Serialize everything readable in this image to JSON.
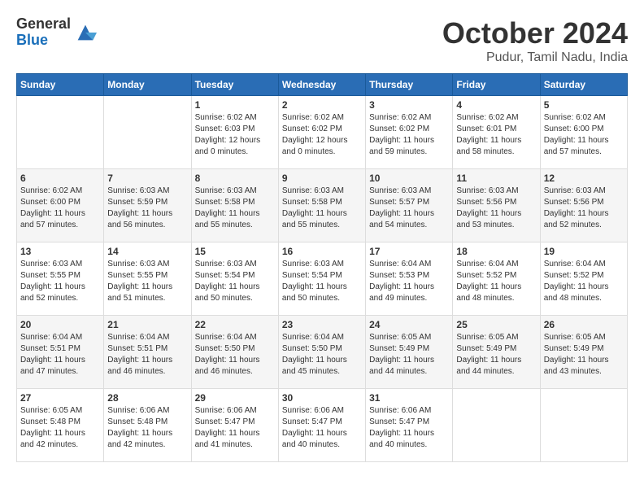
{
  "header": {
    "logo_general": "General",
    "logo_blue": "Blue",
    "title": "October 2024",
    "location": "Pudur, Tamil Nadu, India"
  },
  "calendar": {
    "days_of_week": [
      "Sunday",
      "Monday",
      "Tuesday",
      "Wednesday",
      "Thursday",
      "Friday",
      "Saturday"
    ],
    "weeks": [
      [
        {
          "day": "",
          "sunrise": "",
          "sunset": "",
          "daylight": ""
        },
        {
          "day": "",
          "sunrise": "",
          "sunset": "",
          "daylight": ""
        },
        {
          "day": "1",
          "sunrise": "Sunrise: 6:02 AM",
          "sunset": "Sunset: 6:03 PM",
          "daylight": "Daylight: 12 hours and 0 minutes."
        },
        {
          "day": "2",
          "sunrise": "Sunrise: 6:02 AM",
          "sunset": "Sunset: 6:02 PM",
          "daylight": "Daylight: 12 hours and 0 minutes."
        },
        {
          "day": "3",
          "sunrise": "Sunrise: 6:02 AM",
          "sunset": "Sunset: 6:02 PM",
          "daylight": "Daylight: 11 hours and 59 minutes."
        },
        {
          "day": "4",
          "sunrise": "Sunrise: 6:02 AM",
          "sunset": "Sunset: 6:01 PM",
          "daylight": "Daylight: 11 hours and 58 minutes."
        },
        {
          "day": "5",
          "sunrise": "Sunrise: 6:02 AM",
          "sunset": "Sunset: 6:00 PM",
          "daylight": "Daylight: 11 hours and 57 minutes."
        }
      ],
      [
        {
          "day": "6",
          "sunrise": "Sunrise: 6:02 AM",
          "sunset": "Sunset: 6:00 PM",
          "daylight": "Daylight: 11 hours and 57 minutes."
        },
        {
          "day": "7",
          "sunrise": "Sunrise: 6:03 AM",
          "sunset": "Sunset: 5:59 PM",
          "daylight": "Daylight: 11 hours and 56 minutes."
        },
        {
          "day": "8",
          "sunrise": "Sunrise: 6:03 AM",
          "sunset": "Sunset: 5:58 PM",
          "daylight": "Daylight: 11 hours and 55 minutes."
        },
        {
          "day": "9",
          "sunrise": "Sunrise: 6:03 AM",
          "sunset": "Sunset: 5:58 PM",
          "daylight": "Daylight: 11 hours and 55 minutes."
        },
        {
          "day": "10",
          "sunrise": "Sunrise: 6:03 AM",
          "sunset": "Sunset: 5:57 PM",
          "daylight": "Daylight: 11 hours and 54 minutes."
        },
        {
          "day": "11",
          "sunrise": "Sunrise: 6:03 AM",
          "sunset": "Sunset: 5:56 PM",
          "daylight": "Daylight: 11 hours and 53 minutes."
        },
        {
          "day": "12",
          "sunrise": "Sunrise: 6:03 AM",
          "sunset": "Sunset: 5:56 PM",
          "daylight": "Daylight: 11 hours and 52 minutes."
        }
      ],
      [
        {
          "day": "13",
          "sunrise": "Sunrise: 6:03 AM",
          "sunset": "Sunset: 5:55 PM",
          "daylight": "Daylight: 11 hours and 52 minutes."
        },
        {
          "day": "14",
          "sunrise": "Sunrise: 6:03 AM",
          "sunset": "Sunset: 5:55 PM",
          "daylight": "Daylight: 11 hours and 51 minutes."
        },
        {
          "day": "15",
          "sunrise": "Sunrise: 6:03 AM",
          "sunset": "Sunset: 5:54 PM",
          "daylight": "Daylight: 11 hours and 50 minutes."
        },
        {
          "day": "16",
          "sunrise": "Sunrise: 6:03 AM",
          "sunset": "Sunset: 5:54 PM",
          "daylight": "Daylight: 11 hours and 50 minutes."
        },
        {
          "day": "17",
          "sunrise": "Sunrise: 6:04 AM",
          "sunset": "Sunset: 5:53 PM",
          "daylight": "Daylight: 11 hours and 49 minutes."
        },
        {
          "day": "18",
          "sunrise": "Sunrise: 6:04 AM",
          "sunset": "Sunset: 5:52 PM",
          "daylight": "Daylight: 11 hours and 48 minutes."
        },
        {
          "day": "19",
          "sunrise": "Sunrise: 6:04 AM",
          "sunset": "Sunset: 5:52 PM",
          "daylight": "Daylight: 11 hours and 48 minutes."
        }
      ],
      [
        {
          "day": "20",
          "sunrise": "Sunrise: 6:04 AM",
          "sunset": "Sunset: 5:51 PM",
          "daylight": "Daylight: 11 hours and 47 minutes."
        },
        {
          "day": "21",
          "sunrise": "Sunrise: 6:04 AM",
          "sunset": "Sunset: 5:51 PM",
          "daylight": "Daylight: 11 hours and 46 minutes."
        },
        {
          "day": "22",
          "sunrise": "Sunrise: 6:04 AM",
          "sunset": "Sunset: 5:50 PM",
          "daylight": "Daylight: 11 hours and 46 minutes."
        },
        {
          "day": "23",
          "sunrise": "Sunrise: 6:04 AM",
          "sunset": "Sunset: 5:50 PM",
          "daylight": "Daylight: 11 hours and 45 minutes."
        },
        {
          "day": "24",
          "sunrise": "Sunrise: 6:05 AM",
          "sunset": "Sunset: 5:49 PM",
          "daylight": "Daylight: 11 hours and 44 minutes."
        },
        {
          "day": "25",
          "sunrise": "Sunrise: 6:05 AM",
          "sunset": "Sunset: 5:49 PM",
          "daylight": "Daylight: 11 hours and 44 minutes."
        },
        {
          "day": "26",
          "sunrise": "Sunrise: 6:05 AM",
          "sunset": "Sunset: 5:49 PM",
          "daylight": "Daylight: 11 hours and 43 minutes."
        }
      ],
      [
        {
          "day": "27",
          "sunrise": "Sunrise: 6:05 AM",
          "sunset": "Sunset: 5:48 PM",
          "daylight": "Daylight: 11 hours and 42 minutes."
        },
        {
          "day": "28",
          "sunrise": "Sunrise: 6:06 AM",
          "sunset": "Sunset: 5:48 PM",
          "daylight": "Daylight: 11 hours and 42 minutes."
        },
        {
          "day": "29",
          "sunrise": "Sunrise: 6:06 AM",
          "sunset": "Sunset: 5:47 PM",
          "daylight": "Daylight: 11 hours and 41 minutes."
        },
        {
          "day": "30",
          "sunrise": "Sunrise: 6:06 AM",
          "sunset": "Sunset: 5:47 PM",
          "daylight": "Daylight: 11 hours and 40 minutes."
        },
        {
          "day": "31",
          "sunrise": "Sunrise: 6:06 AM",
          "sunset": "Sunset: 5:47 PM",
          "daylight": "Daylight: 11 hours and 40 minutes."
        },
        {
          "day": "",
          "sunrise": "",
          "sunset": "",
          "daylight": ""
        },
        {
          "day": "",
          "sunrise": "",
          "sunset": "",
          "daylight": ""
        }
      ]
    ]
  }
}
